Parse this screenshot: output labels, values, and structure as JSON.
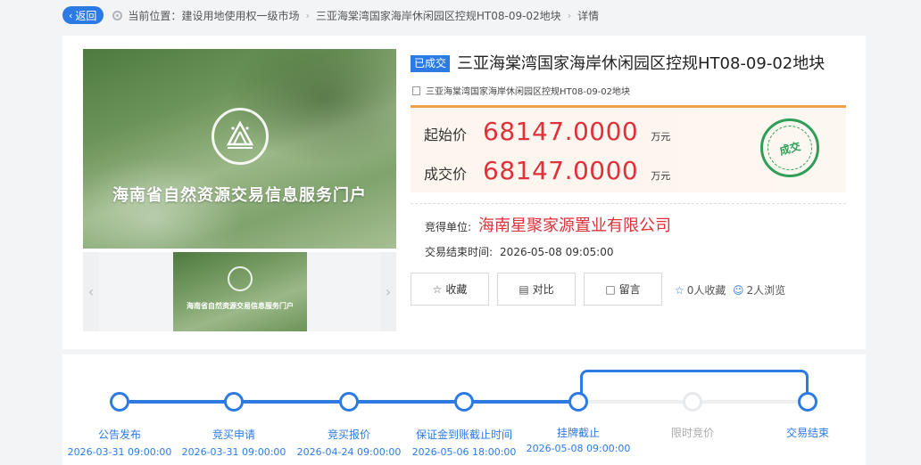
{
  "breadcrumb": {
    "back_label": "返回",
    "prefix": "当前位置：",
    "items": [
      "建设用地使用权一级市场",
      "三亚海棠湾国家海岸休闲园区控规HT08-09-02地块",
      "详情"
    ]
  },
  "gallery": {
    "banner_text": "海南省自然资源交易信息服务门户",
    "thumb_text": "海南省自然资源交易信息服务门户",
    "prev_icon": "chevron-left-icon",
    "next_icon": "chevron-right-icon"
  },
  "lot": {
    "status": "已成交",
    "title": "三亚海棠湾国家海岸休闲园区控规HT08-09-02地块",
    "subtitle": "三亚海棠湾国家海岸休闲园区控规HT08-09-02地块"
  },
  "prices": {
    "start_label": "起始价",
    "start_value": "68147.0000",
    "start_unit": "万元",
    "deal_label": "成交价",
    "deal_value": "68147.0000",
    "deal_unit": "万元",
    "stamp_text": "成交"
  },
  "result": {
    "winner_label": "竞得单位:",
    "winner_value": "海南星聚家源置业有限公司",
    "end_label": "交易结束时间:",
    "end_value": "2026-05-08 09:05:00"
  },
  "actions": {
    "favorite_label": "收藏",
    "compare_label": "对比",
    "message_label": "留言",
    "favorites_count": "0人收藏",
    "views_count": "2人浏览"
  },
  "timeline": {
    "steps": [
      {
        "label": "公告发布",
        "date": "2026-03-31 09:00:00"
      },
      {
        "label": "竞买申请",
        "date": "2026-03-31 09:00:00"
      },
      {
        "label": "竞买报价",
        "date": "2026-04-24 09:00:00"
      },
      {
        "label": "保证金到账截止时间",
        "date": "2026-05-06 18:00:00"
      },
      {
        "label": "挂牌截止",
        "date": "2026-05-08 09:00:00"
      },
      {
        "label": "限时竞价",
        "date": ""
      },
      {
        "label": "交易结束",
        "date": ""
      }
    ]
  },
  "colors": {
    "accent": "#2c7be5",
    "price": "#e0303a",
    "stamp": "#2f9e58",
    "price_border": "#f0a04b"
  }
}
